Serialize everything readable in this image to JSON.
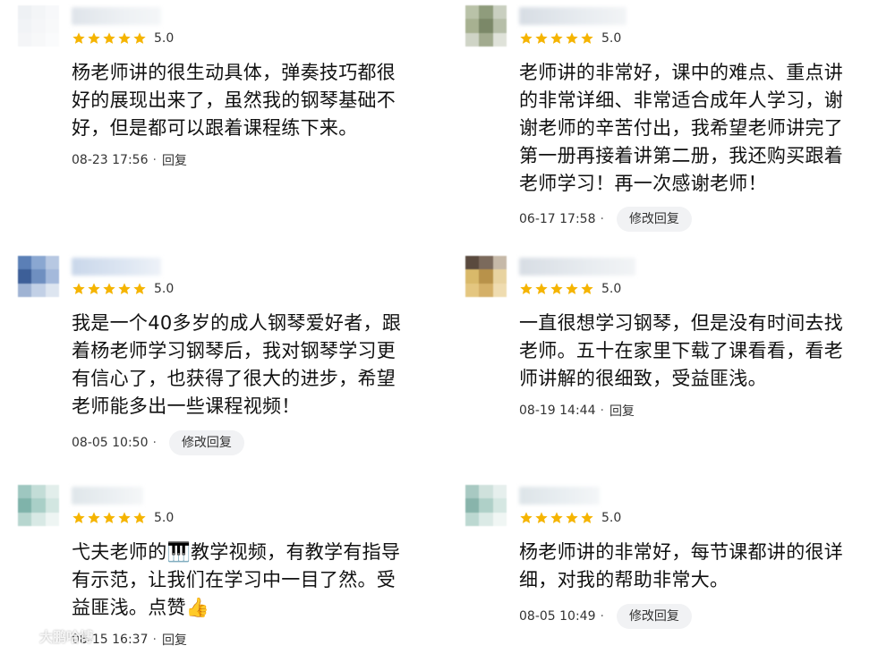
{
  "reviews": [
    {
      "score": "5.0",
      "text": "杨老师讲的很生动具体，弹奏技巧都很\n好的展现出来了，虽然我的钢琴基础不\n好，但是都可以跟着课程练下来。",
      "time": "08-23 17:56",
      "reply": "回复"
    },
    {
      "score": "5.0",
      "text": "老师讲的非常好，课中的难点、重点讲\n的非常详细、非常适合成年人学习，谢\n谢老师的辛苦付出，我希望老师讲完了\n第一册再接着讲第二册，我还购买跟着\n老师学习！再一次感谢老师！",
      "time": "06-17 17:58",
      "reply": "修改回复"
    },
    {
      "score": "5.0",
      "text": "我是一个40多岁的成人钢琴爱好者，跟\n着杨老师学习钢琴后，我对钢琴学习更\n有信心了，也获得了很大的进步，希望\n老师能多出一些课程视频！",
      "time": "08-05 10:50",
      "reply": "修改回复"
    },
    {
      "score": "5.0",
      "text": "一直很想学习钢琴，但是没有时间去找\n老师。五十在家里下载了课看看，看老\n师讲解的很细致，受益匪浅。",
      "time": "08-19 14:44",
      "reply": "回复"
    },
    {
      "score": "5.0",
      "text": "弋夫老师的🎹教学视频，有教学有指导\n有示范，让我们在学习中一目了然。受\n益匪浅。点赞👍",
      "time": "08-15 16:37",
      "reply": "回复"
    },
    {
      "score": "5.0",
      "text": "杨老师讲的非常好，每节课都讲的很详\n细，对我的帮助非常大。",
      "time": "08-05 10:49",
      "reply": "修改回复"
    }
  ],
  "colors": {
    "star": "#f5b400",
    "edit_button_bg": "#f1f2f4"
  },
  "icons": {
    "star": "star-icon",
    "watermark_logo": "weibo-logo-icon"
  },
  "watermark": {
    "text": "大鹏哈博"
  }
}
